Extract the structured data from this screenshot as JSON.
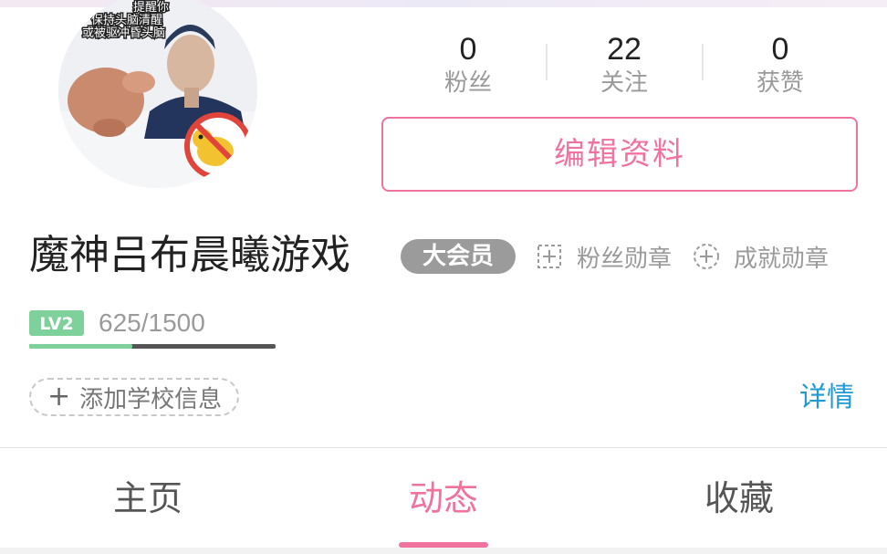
{
  "stats": [
    {
      "key": "fans",
      "value": "0",
      "label": "粉丝"
    },
    {
      "key": "following",
      "value": "22",
      "label": "关注"
    },
    {
      "key": "likes",
      "value": "0",
      "label": "获赞"
    }
  ],
  "edit_profile_label": "编辑资料",
  "user": {
    "name": "魔神吕布晨曦游戏",
    "vip_badge": "大会员",
    "level_label": "LV2",
    "exp_text": "625/1500",
    "exp_progress": 0.4167
  },
  "medals": {
    "fan_medal": "粉丝勋章",
    "achievement_medal": "成就勋章"
  },
  "school_button": "添加学校信息",
  "details_link": "详情",
  "tabs": [
    {
      "label": "主页",
      "active": false
    },
    {
      "label": "动态",
      "active": true
    },
    {
      "label": "收藏",
      "active": false
    }
  ],
  "avatar_caption_lines": [
    "提醒你",
    "保持头脑清醒",
    "或被驱冲昏头脑"
  ],
  "colors": {
    "accent_pink": "#f0739d",
    "link_blue": "#1f9ad6",
    "level_green": "#7fd19c",
    "muted_gray": "#9a9a9a"
  }
}
